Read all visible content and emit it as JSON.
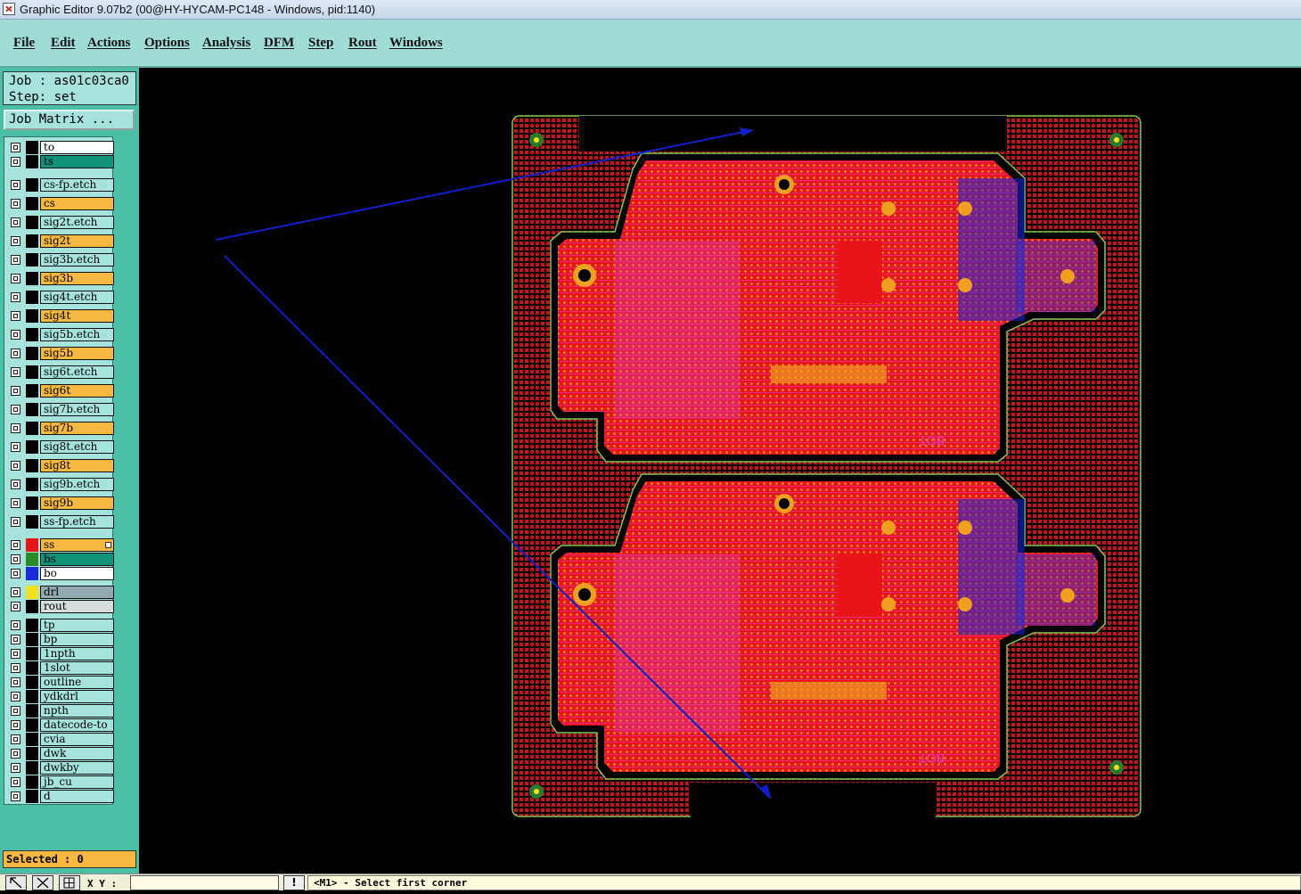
{
  "window": {
    "title": "Graphic Editor 9.07b2 (00@HY-HYCAM-PC148 - Windows, pid:1140)"
  },
  "menu": [
    "File",
    "Edit",
    "Actions",
    "Options",
    "Analysis",
    "DFM",
    "Step",
    "Rout",
    "Windows"
  ],
  "job": {
    "job_line": "Job : as01c03ca0",
    "step_line": "Step: set",
    "matrix_label": "Job Matrix ..."
  },
  "layers": [
    {
      "name": "to",
      "color": "#ffffff"
    },
    {
      "name": "ts",
      "color": "#11917a"
    },
    {
      "name": "cs-fp.etch",
      "color": "#a6e3dc"
    },
    {
      "name": "cs",
      "color": "#f5b941"
    },
    {
      "name": "sig2t.etch",
      "color": "#a6e3dc"
    },
    {
      "name": "sig2t",
      "color": "#f5b941"
    },
    {
      "name": "sig3b.etch",
      "color": "#a6e3dc"
    },
    {
      "name": "sig3b",
      "color": "#f5b941"
    },
    {
      "name": "sig4t.etch",
      "color": "#a6e3dc"
    },
    {
      "name": "sig4t",
      "color": "#f5b941"
    },
    {
      "name": "sig5b.etch",
      "color": "#a6e3dc"
    },
    {
      "name": "sig5b",
      "color": "#f5b941"
    },
    {
      "name": "sig6t.etch",
      "color": "#a6e3dc"
    },
    {
      "name": "sig6t",
      "color": "#f5b941"
    },
    {
      "name": "sig7b.etch",
      "color": "#a6e3dc"
    },
    {
      "name": "sig7b",
      "color": "#f5b941"
    },
    {
      "name": "sig8t.etch",
      "color": "#a6e3dc"
    },
    {
      "name": "sig8t",
      "color": "#f5b941"
    },
    {
      "name": "sig9b.etch",
      "color": "#a6e3dc"
    },
    {
      "name": "sig9b",
      "color": "#f5b941"
    },
    {
      "name": "ss-fp.etch",
      "color": "#a6e3dc"
    },
    {
      "name": "ss",
      "color": "#f5b941",
      "swatch": "#e8141a",
      "active": true
    },
    {
      "name": "bs",
      "color": "#11917a",
      "swatch": "#2a8a2a"
    },
    {
      "name": "bo",
      "color": "#ffffff",
      "swatch": "#1a2ad8"
    },
    {
      "name": "drl",
      "color": "#93a9b0",
      "swatch": "#f0e020"
    },
    {
      "name": "rout",
      "color": "#d7dcdc"
    },
    {
      "name": "tp",
      "color": "#a6e3dc"
    },
    {
      "name": "bp",
      "color": "#a6e3dc"
    },
    {
      "name": "1npth",
      "color": "#a6e3dc"
    },
    {
      "name": "1slot",
      "color": "#a6e3dc"
    },
    {
      "name": "outline",
      "color": "#a6e3dc"
    },
    {
      "name": "ydkdrl",
      "color": "#a6e3dc"
    },
    {
      "name": "npth",
      "color": "#a6e3dc"
    },
    {
      "name": "datecode-to",
      "color": "#a6e3dc"
    },
    {
      "name": "cvia",
      "color": "#a6e3dc"
    },
    {
      "name": "dwk",
      "color": "#a6e3dc"
    },
    {
      "name": "dwkby",
      "color": "#a6e3dc"
    },
    {
      "name": "jb_cu",
      "color": "#a6e3dc"
    },
    {
      "name": "d",
      "color": "#a6e3dc"
    }
  ],
  "status": {
    "selected": "Selected : 0",
    "xy_label": "X Y :",
    "coord_value": "",
    "warn": "!",
    "prompt": "<M1> - Select first corner"
  },
  "board": {
    "silk_label": "BOT",
    "copper": "#e8141a",
    "grid": "#c81018",
    "outline": "#7cc850",
    "mesh": "#f0a020"
  }
}
